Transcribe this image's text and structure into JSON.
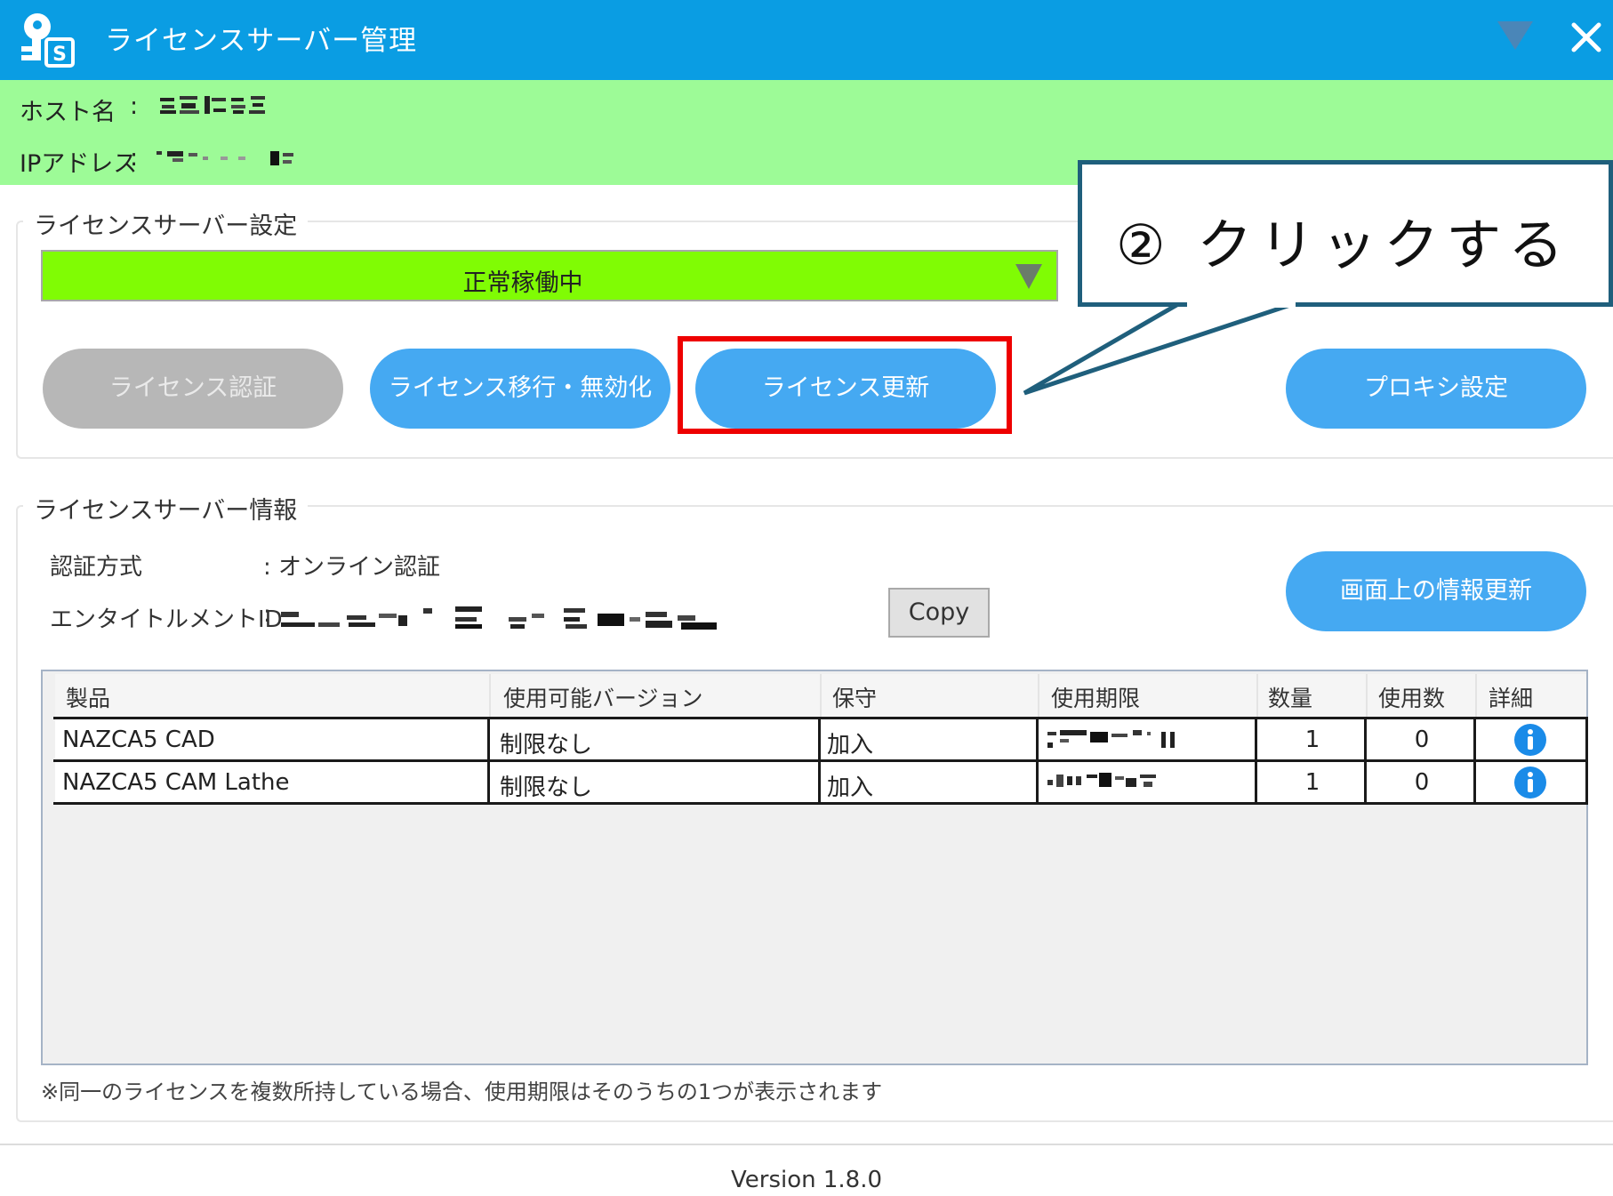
{
  "window": {
    "title": "ライセンスサーバー管理",
    "app_icon": "key-s-icon",
    "menu_icon": "triangle-down-icon",
    "close_icon": "close-icon"
  },
  "host": {
    "hostname_label": "ホスト名",
    "ip_label": "IPアドレス",
    "separator": ":"
  },
  "server_settings": {
    "legend": "ライセンスサーバー設定",
    "status": "正常稼働中",
    "buttons": {
      "certify": "ライセンス認証",
      "migrate": "ライセンス移行・無効化",
      "renew": "ライセンス更新",
      "proxy": "プロキシ設定"
    }
  },
  "callout": {
    "text": "② クリックする"
  },
  "server_info": {
    "legend": "ライセンスサーバー情報",
    "auth_label": "認証方式",
    "auth_value": ": オンライン認証",
    "entitlement_label": "エンタイトルメントID",
    "entitlement_sep": ":",
    "copy_label": "Copy",
    "refresh_label": "画面上の情報更新"
  },
  "table": {
    "headers": [
      "製品",
      "使用可能バージョン",
      "保守",
      "使用期限",
      "数量",
      "使用数",
      "詳細"
    ],
    "rows": [
      {
        "product": "NAZCA5 CAD",
        "version": "制限なし",
        "maintenance": "加入",
        "quantity": "1",
        "used": "0"
      },
      {
        "product": "NAZCA5 CAM Lathe",
        "version": "制限なし",
        "maintenance": "加入",
        "quantity": "1",
        "used": "0"
      }
    ]
  },
  "note": "※同一のライセンスを複数所持している場合、使用期限はそのうちの1つが表示されます",
  "version": "Version 1.8.0",
  "colors": {
    "titlebar": "#0a9de3",
    "host_band": "#9dfb97",
    "status_green": "#80fc04",
    "button_blue": "#45a9f2",
    "highlight_red": "#ee0000",
    "callout_border": "#1f5f7c",
    "info_icon": "#1a8be8"
  }
}
